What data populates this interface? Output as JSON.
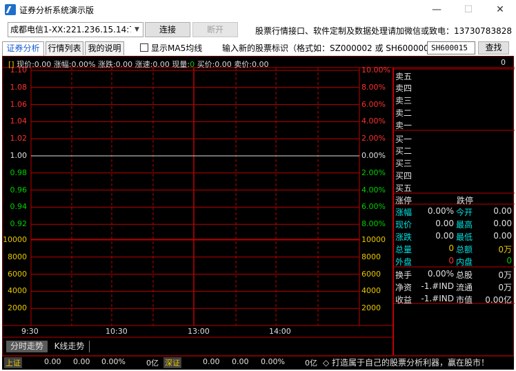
{
  "window": {
    "title": "证券分析系统演示版",
    "minimize": "—",
    "maximize": "☐",
    "close": "✕"
  },
  "toolbar": {
    "server": "成都电信1-XX:221.236.15.14:77",
    "connect_label": "连接",
    "disconnect_label": "断开",
    "ad_text": "股票行情接口、软件定制及数据处理请加微信或致电：13730783828"
  },
  "tabs": [
    "证券分析",
    "行情列表",
    "我的说明"
  ],
  "options": {
    "ma5_label": "显示MA5均线",
    "ma5_checked": false,
    "input_label": "输入新的股票标识（格式如：SZ000002 或 SH600000）：",
    "stock_code": "SH600015",
    "search_label": "查找"
  },
  "infobar": {
    "bracket": "[]",
    "now_price": "现价:0.00",
    "change_pct": "涨幅:0.00%",
    "change": "涨跌:0.00",
    "speed": "涨速:0.00",
    "volume_label": "现量:",
    "volume_value": "0",
    "bid": "买价:0.00",
    "ask": "卖价:0.00",
    "right_value": "0"
  },
  "chart": {
    "price_levels": [
      "1.10",
      "1.08",
      "1.06",
      "1.04",
      "1.02",
      "1.00",
      "0.98",
      "0.96",
      "0.94",
      "0.92"
    ],
    "pct_levels": [
      "10.00%",
      "8.00%",
      "6.00%",
      "4.00%",
      "2.00%",
      "0.00%",
      "2.00%",
      "4.00%",
      "6.00%",
      "8.00%"
    ],
    "volume_levels": [
      "10000",
      "8000",
      "6000",
      "4000",
      "2000"
    ],
    "time_labels": [
      "9:30",
      "10:30",
      "13:00",
      "14:00"
    ],
    "colors": {
      "up": "#ff3030",
      "flat": "#e0e0e0",
      "down": "#00d000",
      "volume": "#e8c800",
      "grid": "#c00000"
    }
  },
  "orderbook": {
    "sell": [
      "卖五",
      "卖四",
      "卖三",
      "卖二",
      "卖一"
    ],
    "buy": [
      "买一",
      "买二",
      "买三",
      "买四",
      "买五"
    ]
  },
  "limits": {
    "limit_up": "涨停",
    "limit_down": "跌停"
  },
  "stats": {
    "change_pct": {
      "label": "涨幅",
      "value": "0.00%"
    },
    "open": {
      "label": "今开",
      "value": "0.00"
    },
    "now": {
      "label": "现价",
      "value": "0.00"
    },
    "high": {
      "label": "最高",
      "value": "0.00"
    },
    "change": {
      "label": "涨跌",
      "value": "0.00"
    },
    "low": {
      "label": "最低",
      "value": "0.00"
    },
    "volume": {
      "label": "总量",
      "value": "0"
    },
    "amount": {
      "label": "总额",
      "value": "0万"
    },
    "outer": {
      "label": "外盘",
      "value": "0"
    },
    "inner": {
      "label": "内盘",
      "value": "0"
    },
    "turnover": {
      "label": "换手",
      "value": "0.00%"
    },
    "total_shares": {
      "label": "总股",
      "value": "0万"
    },
    "net_assets": {
      "label": "净资",
      "value": "-1.#IND"
    },
    "float_shares": {
      "label": "流通",
      "value": "0万"
    },
    "earnings": {
      "label": "收益",
      "value": "-1.#IND"
    },
    "market_cap": {
      "label": "市值",
      "value": "0.00亿"
    }
  },
  "bottom_tabs": [
    "分时走势",
    "K线走势"
  ],
  "statusbar": {
    "sh_label": "上证",
    "sh_values": [
      "0.00",
      "0.00",
      "0.00%",
      "0亿"
    ],
    "sz_label": "深证",
    "sz_values": [
      "0.00",
      "0.00",
      "0.00%",
      "0亿"
    ],
    "slogan": "◇ 打造属于自己的股票分析利器，赢在股市！"
  }
}
